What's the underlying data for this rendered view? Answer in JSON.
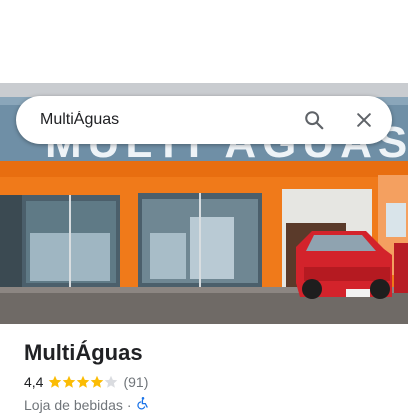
{
  "search": {
    "query": "MultiÁguas"
  },
  "hero": {
    "sign_text": "MULTI ÁGUAS"
  },
  "place": {
    "name": "MultiÁguas",
    "rating": "4,4",
    "stars_value": 4.4,
    "stars_max": 5,
    "review_count": "(91)",
    "category": "Loja de bebidas",
    "separator": "·"
  },
  "colors": {
    "star": "#fbbc04",
    "facade_orange": "#f07a1a",
    "car_red": "#d3232b"
  },
  "icons": {
    "search": "search-icon",
    "close": "close-icon",
    "accessibility": "wheelchair-icon"
  }
}
